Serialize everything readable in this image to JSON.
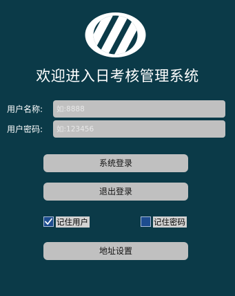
{
  "app": {
    "logo_icon": "diagonal-stripes-logo-icon",
    "title": "欢迎进入日考核管理系统"
  },
  "form": {
    "username_label": "用户名称:",
    "username_value": "",
    "username_placeholder": "如:8888",
    "password_label": "用户密码:",
    "password_value": "",
    "password_placeholder": "如:123456"
  },
  "buttons": {
    "login_label": "系统登录",
    "logout_label": "退出登录",
    "address_settings_label": "地址设置"
  },
  "options": {
    "remember_user_label": "记住用户",
    "remember_user_checked": true,
    "remember_password_label": "记住密码",
    "remember_password_checked": false
  },
  "colors": {
    "background": "#0b3a48",
    "control_gray": "#c0c0c0",
    "checkbox_blue": "#1d4c8f"
  }
}
